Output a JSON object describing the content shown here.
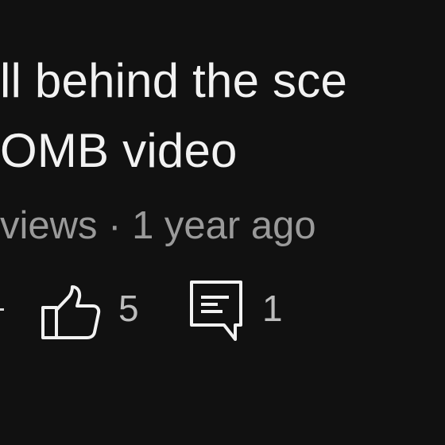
{
  "video": {
    "title_line_1": "ll behind the sce",
    "title_line_2": "OMB video",
    "meta": "views · 1 year ago"
  },
  "actions": {
    "likes": "5",
    "comments": "1",
    "like_icon": "thumbs-up-icon",
    "comment_icon": "comment-icon"
  },
  "colors": {
    "background": "#111111",
    "title_text": "#f2f2f2",
    "meta_text": "#9a9a9a",
    "count_text": "#bdbdbd"
  }
}
